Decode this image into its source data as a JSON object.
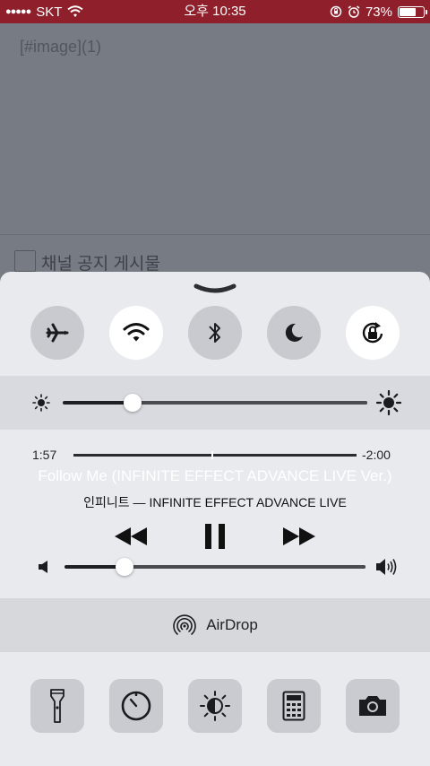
{
  "status_bar": {
    "signal": "●●●●●",
    "carrier": "SKT",
    "time": "오후 10:35",
    "battery": "73%",
    "battery_level": 0.73,
    "background_color": "#8e1f2b"
  },
  "background_app": {
    "text_line_1": "",
    "text_line_2": "[#image](1)",
    "checkbox_label": "채널 공지 게시물"
  },
  "control_center": {
    "toggles": [
      {
        "name": "airplane-mode",
        "icon": "airplane-icon",
        "on": false
      },
      {
        "name": "wifi",
        "icon": "wifi-icon",
        "on": true
      },
      {
        "name": "bluetooth",
        "icon": "bluetooth-icon",
        "on": false
      },
      {
        "name": "do-not-disturb",
        "icon": "moon-icon",
        "on": false
      },
      {
        "name": "rotation-lock",
        "icon": "rotation-lock-icon",
        "on": true
      }
    ],
    "brightness": {
      "level": 0.23
    },
    "media": {
      "elapsed": "1:57",
      "remaining": "-2:00",
      "progress": 0.49,
      "title": "Follow Me (INFINITE EFFECT ADVANCE LIVE Ver.)",
      "subtitle": "인피니트 — INFINITE EFFECT ADVANCE LIVE",
      "volume": 0.2
    },
    "airdrop": {
      "label": "AirDrop"
    },
    "shortcuts": [
      {
        "name": "flashlight",
        "icon": "flashlight-icon"
      },
      {
        "name": "timer",
        "icon": "timer-icon"
      },
      {
        "name": "night-shift",
        "icon": "night-shift-icon"
      },
      {
        "name": "calculator",
        "icon": "calculator-icon"
      },
      {
        "name": "camera",
        "icon": "camera-icon"
      }
    ],
    "accent": "#ffffff",
    "panel_color": "#e9eaee"
  }
}
